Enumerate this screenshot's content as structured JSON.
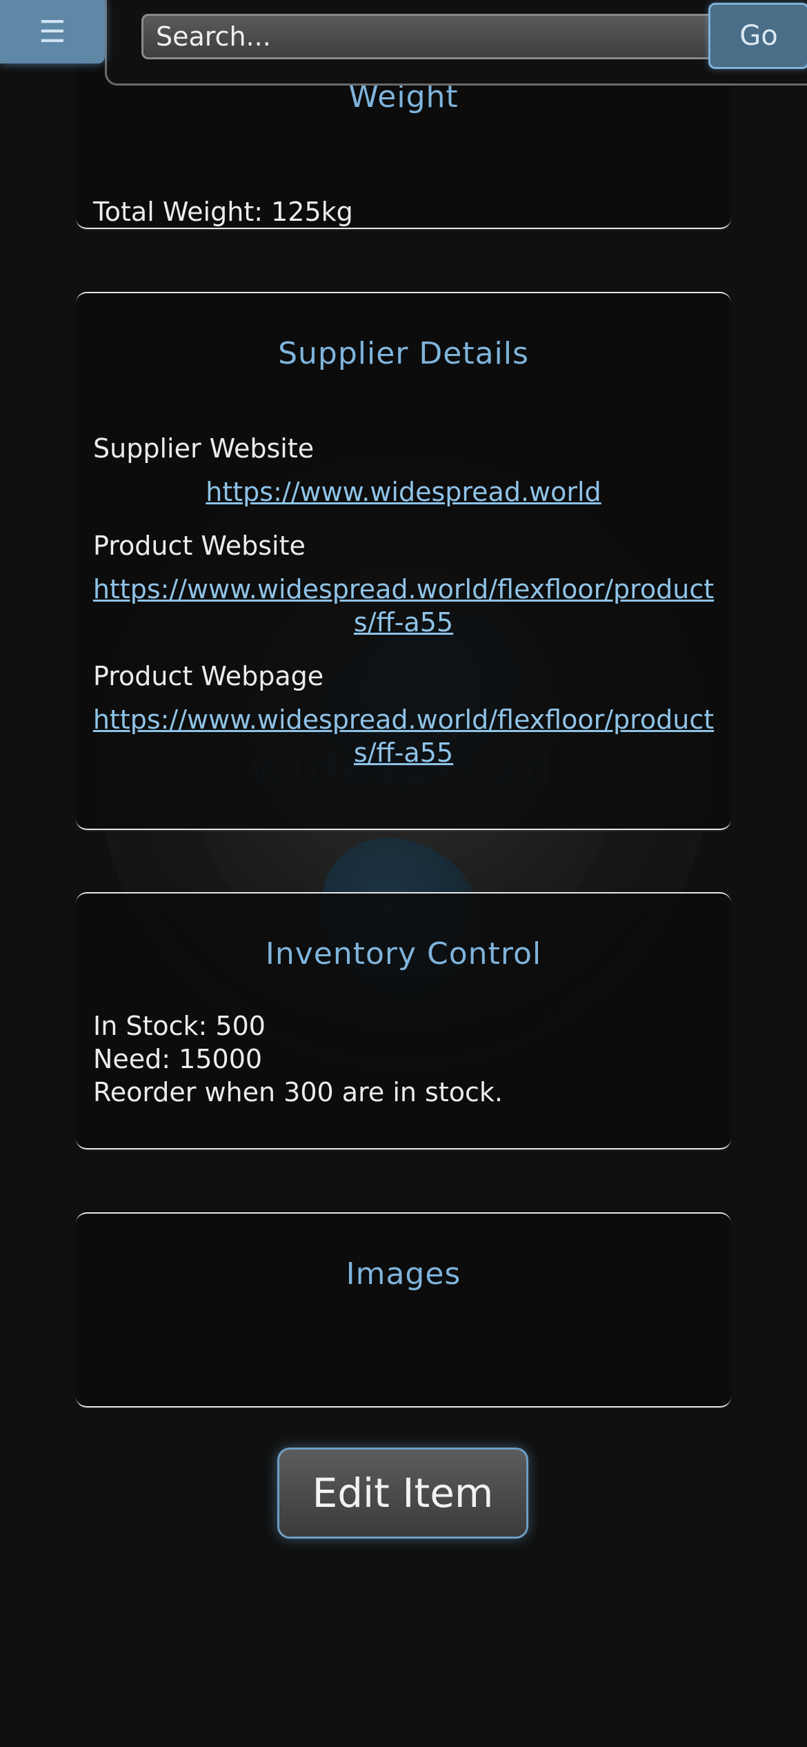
{
  "header": {
    "menu_icon": "☰",
    "search_placeholder": "Search...",
    "go_label": "Go"
  },
  "background": {
    "watermark_text": "widespread"
  },
  "weight": {
    "title": "Weight",
    "total": "Total Weight: 125kg"
  },
  "supplier": {
    "title": "Supplier Details",
    "supplier_website_label": "Supplier Website",
    "supplier_website_url": "https://www.widespread.world",
    "product_website_label": "Product Website",
    "product_website_url": "https://www.widespread.world/flexfloor/products/ff-a55",
    "product_webpage_label": "Product Webpage",
    "product_webpage_url": "https://www.widespread.world/flexfloor/products/ff-a55"
  },
  "inventory": {
    "title": "Inventory Control",
    "in_stock": "In Stock: 500",
    "need": "Need: 15000",
    "reorder": "Reorder when 300 are in stock."
  },
  "images": {
    "title": "Images"
  },
  "actions": {
    "edit_label": "Edit Item"
  },
  "colors": {
    "accent": "#7fb4dc",
    "link": "#8fc3e8",
    "background": "#101010"
  }
}
